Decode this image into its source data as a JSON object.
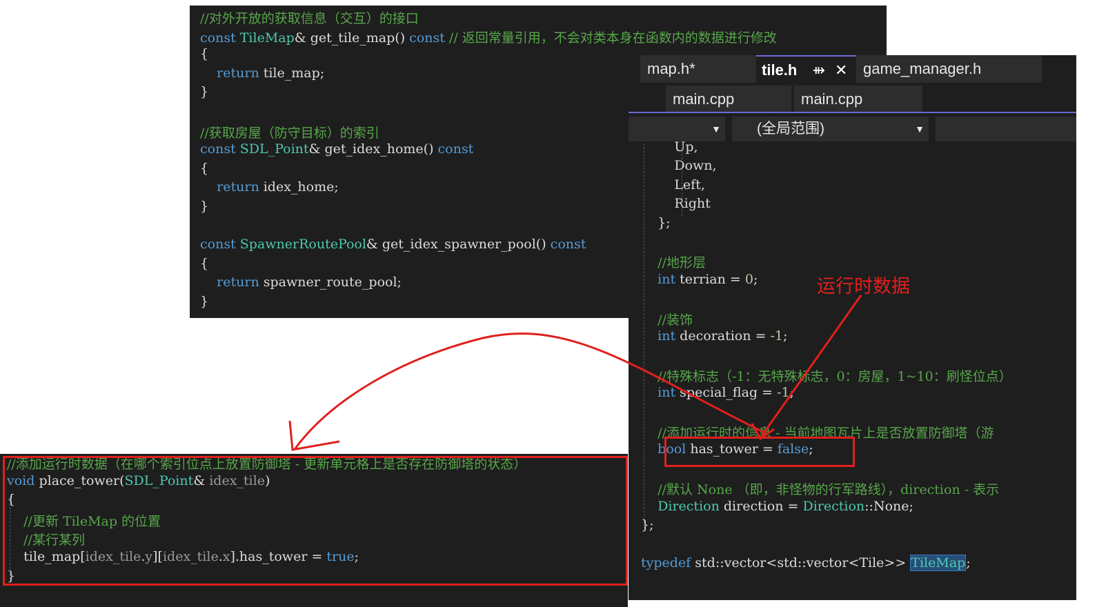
{
  "top_panel": {
    "lines": [
      {
        "t": "cm",
        "v": "//对外开放的获取信息（交互）的接口"
      },
      {
        "parts": [
          [
            "kw",
            "const "
          ],
          [
            "ty",
            "TileMap"
          ],
          [
            "pl",
            "& get_tile_map() "
          ],
          [
            "kw",
            "const"
          ],
          [
            "cm",
            " // 返回常量引用，不会对类本身在函数内的数据进行修改"
          ]
        ]
      },
      {
        "parts": [
          [
            "pl",
            "{"
          ]
        ]
      },
      {
        "parts": [
          [
            "kw",
            "    return "
          ],
          [
            "pl",
            "tile_map;"
          ]
        ]
      },
      {
        "parts": [
          [
            "pl",
            "}"
          ]
        ]
      },
      {
        "parts": [
          [
            "pl",
            ""
          ]
        ]
      },
      {
        "t": "cm",
        "v": "//获取房屋（防守目标）的索引"
      },
      {
        "parts": [
          [
            "kw",
            "const "
          ],
          [
            "ty",
            "SDL_Point"
          ],
          [
            "pl",
            "& get_idex_home() "
          ],
          [
            "kw",
            "const"
          ]
        ]
      },
      {
        "parts": [
          [
            "pl",
            "{"
          ]
        ]
      },
      {
        "parts": [
          [
            "kw",
            "    return "
          ],
          [
            "pl",
            "idex_home;"
          ]
        ]
      },
      {
        "parts": [
          [
            "pl",
            "}"
          ]
        ]
      },
      {
        "parts": [
          [
            "pl",
            ""
          ]
        ]
      },
      {
        "parts": [
          [
            "kw",
            "const "
          ],
          [
            "ty",
            "SpawnerRoutePool"
          ],
          [
            "pl",
            "& get_idex_spawner_pool() "
          ],
          [
            "kw",
            "const"
          ]
        ]
      },
      {
        "parts": [
          [
            "pl",
            "{"
          ]
        ]
      },
      {
        "parts": [
          [
            "kw",
            "    return "
          ],
          [
            "pl",
            "spawner_route_pool;"
          ]
        ]
      },
      {
        "parts": [
          [
            "pl",
            "}"
          ]
        ]
      }
    ]
  },
  "editor": {
    "tabs": [
      "map.h*",
      "tile.h",
      "game_manager.h"
    ],
    "pin_icon": "⇻",
    "close_icon": "✕",
    "tabs2": [
      "main.cpp",
      "main.cpp"
    ],
    "scope": "(全局范围)",
    "lines": [
      {
        "parts": [
          [
            "pl",
            "        Up,"
          ]
        ]
      },
      {
        "parts": [
          [
            "pl",
            "        Down,"
          ]
        ]
      },
      {
        "parts": [
          [
            "pl",
            "        Left,"
          ]
        ]
      },
      {
        "parts": [
          [
            "pl",
            "        Right"
          ]
        ]
      },
      {
        "parts": [
          [
            "pl",
            "    };"
          ]
        ]
      },
      {
        "parts": [
          [
            "pl",
            ""
          ]
        ]
      },
      {
        "t": "cm",
        "v": "    //地形层"
      },
      {
        "parts": [
          [
            "kw",
            "    int "
          ],
          [
            "pl",
            "terrian = "
          ],
          [
            "nm",
            "0"
          ],
          [
            "pl",
            ";"
          ]
        ]
      },
      {
        "parts": [
          [
            "pl",
            ""
          ]
        ]
      },
      {
        "t": "cm",
        "v": "    //装饰"
      },
      {
        "parts": [
          [
            "kw",
            "    int "
          ],
          [
            "pl",
            "decoration = "
          ],
          [
            "nm",
            "-1"
          ],
          [
            "pl",
            ";"
          ]
        ]
      },
      {
        "parts": [
          [
            "pl",
            ""
          ]
        ]
      },
      {
        "t": "cm",
        "v": "    //特殊标志（-1：无特殊标志，0：房屋，1~10：刷怪位点）"
      },
      {
        "parts": [
          [
            "kw",
            "    int "
          ],
          [
            "pl",
            "special_flag = "
          ],
          [
            "nm",
            "-1"
          ],
          [
            "pl",
            ";"
          ]
        ]
      },
      {
        "parts": [
          [
            "pl",
            ""
          ]
        ]
      },
      {
        "t": "cm",
        "v": "    //添加运行时的信息 - 当前地图瓦片上是否放置防御塔（游"
      },
      {
        "parts": [
          [
            "kw",
            "    bool "
          ],
          [
            "pl",
            "has_tower = "
          ],
          [
            "kw",
            "false"
          ],
          [
            "pl",
            ";"
          ]
        ]
      },
      {
        "parts": [
          [
            "pl",
            ""
          ]
        ]
      },
      {
        "t": "cm",
        "v": "    //默认 None （即，非怪物的行军路线），direction - 表示"
      },
      {
        "parts": [
          [
            "ty",
            "    Direction "
          ],
          [
            "pl",
            "direction = "
          ],
          [
            "ty",
            "Direction"
          ],
          [
            "pl",
            "::"
          ],
          [
            "pl",
            "None;"
          ]
        ]
      },
      {
        "parts": [
          [
            "pl",
            "};"
          ]
        ]
      },
      {
        "parts": [
          [
            "pl",
            ""
          ]
        ]
      },
      {
        "parts": [
          [
            "kw",
            "typedef "
          ],
          [
            "pl",
            "std::vector<std::vector<Tile>> "
          ],
          [
            "hl",
            "TileMap"
          ],
          [
            "pl",
            ";"
          ]
        ]
      }
    ]
  },
  "bottom_panel": {
    "lines": [
      {
        "t": "cm",
        "v": "//添加运行时数据（在哪个索引位点上放置防御塔 - 更新单元格上是否存在防御塔的状态）"
      },
      {
        "parts": [
          [
            "kw",
            "void "
          ],
          [
            "pl",
            "place_tower("
          ],
          [
            "ty",
            "SDL_Point"
          ],
          [
            "pl",
            "& "
          ],
          [
            "dim",
            "idex_tile"
          ],
          [
            "pl",
            ")"
          ]
        ]
      },
      {
        "parts": [
          [
            "pl",
            "{"
          ]
        ]
      },
      {
        "t": "cm",
        "v": "    //更新 TileMap 的位置"
      },
      {
        "t": "cm",
        "v": "    //某行某列"
      },
      {
        "parts": [
          [
            "pl",
            "    tile_map["
          ],
          [
            "dim",
            "idex_tile"
          ],
          [
            "pl",
            "."
          ],
          [
            "dim",
            "y"
          ],
          [
            "pl",
            "]["
          ],
          [
            "dim",
            "idex_tile"
          ],
          [
            "pl",
            "."
          ],
          [
            "dim",
            "x"
          ],
          [
            "pl",
            "].has_tower = "
          ],
          [
            "kw",
            "true"
          ],
          [
            "pl",
            ";"
          ]
        ]
      },
      {
        "parts": [
          [
            "pl",
            "}"
          ]
        ]
      }
    ]
  },
  "annotation": {
    "label": "运行时数据",
    "color": "#e0201c"
  }
}
